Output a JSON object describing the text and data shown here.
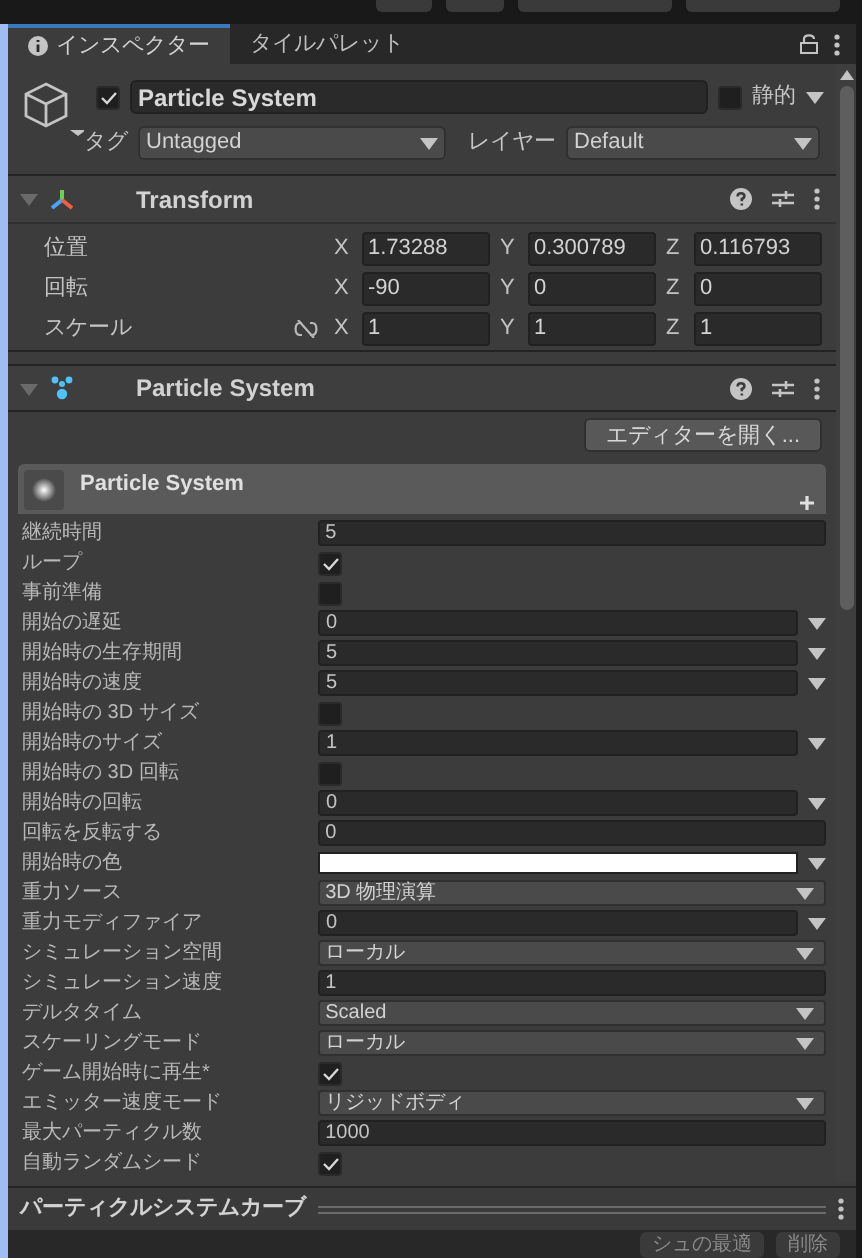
{
  "tabs": [
    {
      "label": "インスペクター",
      "selected": true
    },
    {
      "label": "タイルパレット",
      "selected": false
    }
  ],
  "object": {
    "active": true,
    "name": "Particle System",
    "static": false,
    "static_label": "静的",
    "tag_label": "タグ",
    "tag": "Untagged",
    "layer_label": "レイヤー",
    "layer": "Default"
  },
  "transform": {
    "title": "Transform",
    "expanded": true,
    "rows": [
      {
        "label": "位置",
        "link_icon": false,
        "values": [
          {
            "axis": "X",
            "value": "1.73288"
          },
          {
            "axis": "Y",
            "value": "0.300789"
          },
          {
            "axis": "Z",
            "value": "0.116793"
          }
        ]
      },
      {
        "label": "回転",
        "link_icon": false,
        "values": [
          {
            "axis": "X",
            "value": "-90"
          },
          {
            "axis": "Y",
            "value": "0"
          },
          {
            "axis": "Z",
            "value": "0"
          }
        ]
      },
      {
        "label": "スケール",
        "link_icon": true,
        "values": [
          {
            "axis": "X",
            "value": "1"
          },
          {
            "axis": "Y",
            "value": "1"
          },
          {
            "axis": "Z",
            "value": "1"
          }
        ]
      }
    ]
  },
  "particle_system": {
    "title": "Particle System",
    "expanded": true,
    "open_editor": "エディターを開く...",
    "module_title": "Particle System",
    "properties": [
      {
        "label": "継続時間",
        "kind": "number",
        "value": "5"
      },
      {
        "label": "ループ",
        "kind": "check",
        "checked": true
      },
      {
        "label": "事前準備",
        "kind": "check",
        "checked": false
      },
      {
        "label": "開始の遅延",
        "kind": "curve",
        "value": "0"
      },
      {
        "label": "開始時の生存期間",
        "kind": "curve",
        "value": "5"
      },
      {
        "label": "開始時の速度",
        "kind": "curve",
        "value": "5"
      },
      {
        "label": "開始時の 3D サイズ",
        "kind": "check",
        "checked": false
      },
      {
        "label": "開始時のサイズ",
        "kind": "curve",
        "value": "1"
      },
      {
        "label": "開始時の 3D 回転",
        "kind": "check",
        "checked": false
      },
      {
        "label": "開始時の回転",
        "kind": "curve",
        "value": "0"
      },
      {
        "label": "回転を反転する",
        "kind": "number",
        "value": "0"
      },
      {
        "label": "開始時の色",
        "kind": "color",
        "color": "#ffffff"
      },
      {
        "label": "重力ソース",
        "kind": "dropdown",
        "value": "3D 物理演算"
      },
      {
        "label": "重力モディファイア",
        "kind": "curve",
        "value": "0"
      },
      {
        "label": "シミュレーション空間",
        "kind": "dropdown",
        "value": "ローカル"
      },
      {
        "label": "シミュレーション速度",
        "kind": "number",
        "value": "1"
      },
      {
        "label": "デルタタイム",
        "kind": "dropdown",
        "value": "Scaled"
      },
      {
        "label": "スケーリングモード",
        "kind": "dropdown",
        "value": "ローカル"
      },
      {
        "label": "ゲーム開始時に再生*",
        "kind": "check",
        "checked": true
      },
      {
        "label": "エミッター速度モード",
        "kind": "dropdown",
        "value": "リジッドボディ"
      },
      {
        "label": "最大パーティクル数",
        "kind": "number",
        "value": "1000"
      },
      {
        "label": "自動ランダムシード",
        "kind": "check",
        "checked": true
      }
    ]
  },
  "curves": {
    "title": "パーティクルシステムカーブ"
  },
  "bottom_buttons": [
    "シュの最適",
    "削除"
  ]
}
